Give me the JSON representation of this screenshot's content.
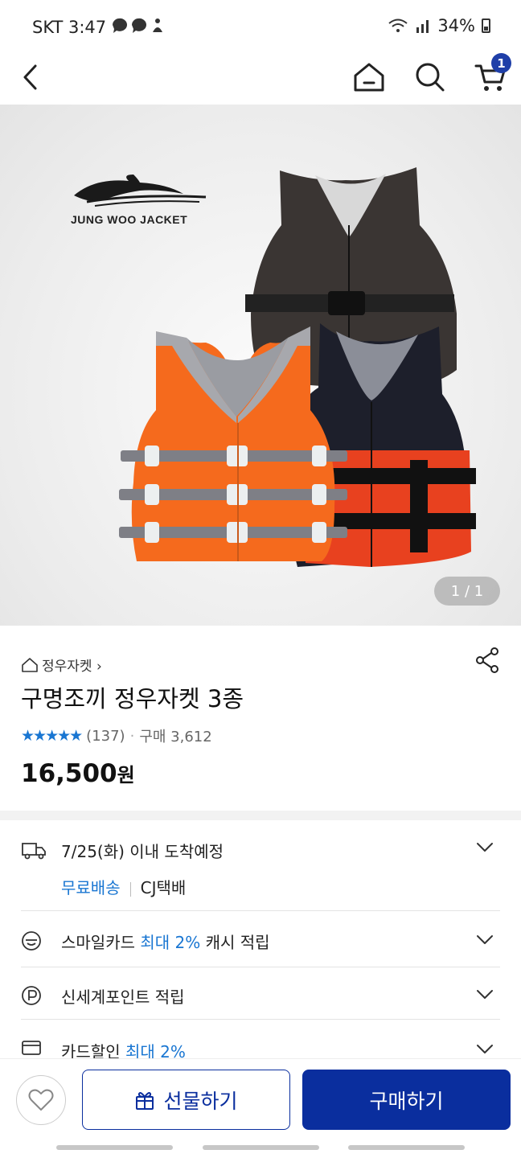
{
  "status": {
    "carrier_time": "SKT 3:47",
    "battery": "34%"
  },
  "nav": {
    "cart_count": "1"
  },
  "hero": {
    "brand_text": "JUNG WOO JACKET",
    "counter": "1 / 1"
  },
  "product": {
    "brand_link": "정우자켓 ›",
    "title": "구명조끼 정우자켓 3종",
    "rating_count": "(137)",
    "dot": "·",
    "purchases": "구매 3,612",
    "price_value": "16,500",
    "price_unit": "원",
    "rating_stars": 5
  },
  "benefits": {
    "delivery_date": "7/25(화) 이내 도착예정",
    "free_shipping": "무료배송",
    "courier": "CJ택배",
    "smile_pre": "스마일카드 ",
    "smile_hl": "최대 2%",
    "smile_post": " 캐시 적립",
    "point": "신세계포인트 적립",
    "card_pre": "카드할인 ",
    "card_hl": "최대 2%"
  },
  "bottom": {
    "gift_label": "선물하기",
    "buy_label": "구매하기"
  },
  "colors": {
    "accent": "#0a2e9e",
    "highlight": "#1976d2",
    "orange": "#f56a1d",
    "red": "#e8411f"
  }
}
